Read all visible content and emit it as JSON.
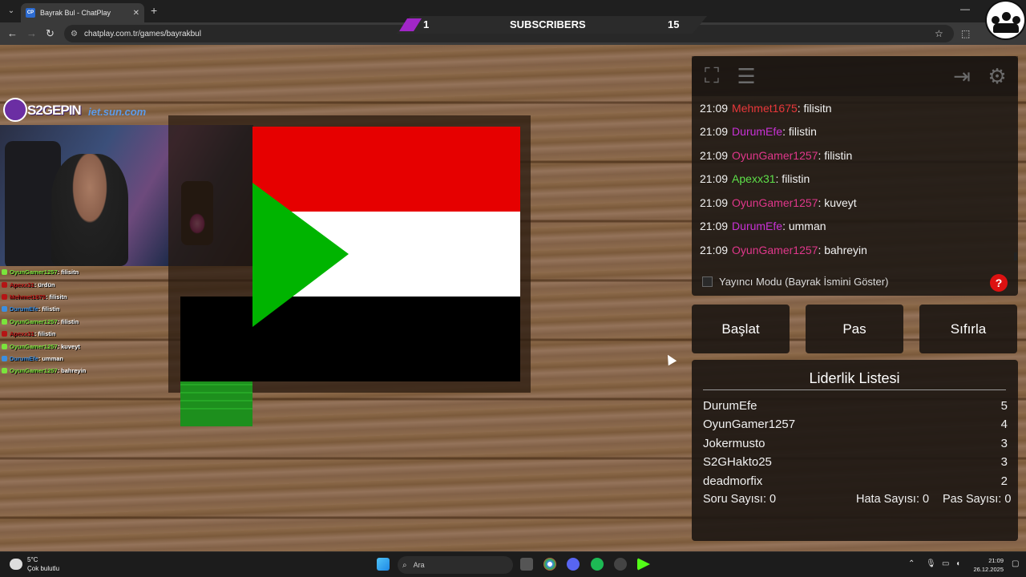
{
  "browser": {
    "tab_title": "Bayrak Bul - ChatPlay",
    "tab_favicon": "CP",
    "url": "chatplay.com.tr/games/bayrakbul"
  },
  "subscribers": {
    "left_value": "1",
    "label": "SUBSCRIBERS",
    "right_value": "15"
  },
  "stream_overlay": {
    "channel_name": "S2GEPIN",
    "sponsor": "iet.sun.com",
    "chat": [
      {
        "user": "OyunGamer1257",
        "msg": "filisitn",
        "color": "#7be33c"
      },
      {
        "user": "Apexx31",
        "msg": "ürdün",
        "color": "#b51515"
      },
      {
        "user": "Mehmet1675",
        "msg": "filisitn",
        "color": "#b51515"
      },
      {
        "user": "DurumEfe",
        "msg": "filistin",
        "color": "#3c8fe0"
      },
      {
        "user": "OyunGamer1257",
        "msg": "filistin",
        "color": "#7be33c"
      },
      {
        "user": "Apexx31",
        "msg": "filistin",
        "color": "#b51515"
      },
      {
        "user": "OyunGamer1257",
        "msg": "kuveyt",
        "color": "#7be33c"
      },
      {
        "user": "DurumEfe",
        "msg": "umman",
        "color": "#3c8fe0"
      },
      {
        "user": "OyunGamer1257",
        "msg": "bahreyin",
        "color": "#7be33c"
      }
    ]
  },
  "flag": {
    "colors": {
      "top": "#e60000",
      "middle": "#ffffff",
      "bottom": "#000000",
      "triangle": "#00b400"
    }
  },
  "panel": {
    "tools": {
      "fullscreen_icon": "expand-icon",
      "list_icon": "document-icon",
      "exit_icon": "exit-icon",
      "settings_icon": "gear-icon"
    },
    "chat": [
      {
        "time": "21:09",
        "user": "Mehmet1675",
        "color": "#e8373a",
        "msg": ": filisitn"
      },
      {
        "time": "21:09",
        "user": "DurumEfe",
        "color": "#c832d6",
        "msg": ": filistin"
      },
      {
        "time": "21:09",
        "user": "OyunGamer1257",
        "color": "#e0378b",
        "msg": ": filistin"
      },
      {
        "time": "21:09",
        "user": "Apexx31",
        "color": "#5ee04a",
        "msg": ": filistin"
      },
      {
        "time": "21:09",
        "user": "OyunGamer1257",
        "color": "#e0378b",
        "msg": ": kuveyt"
      },
      {
        "time": "21:09",
        "user": "DurumEfe",
        "color": "#c832d6",
        "msg": ": umman"
      },
      {
        "time": "21:09",
        "user": "OyunGamer1257",
        "color": "#e0378b",
        "msg": ": bahreyin"
      }
    ],
    "streamer_mode_label": "Yayıncı Modu (Bayrak İsmini Göster)",
    "help_label": "?",
    "buttons": {
      "start": "Başlat",
      "pass": "Pas",
      "reset": "Sıfırla"
    },
    "leaderboard": {
      "title": "Liderlik Listesi",
      "rows": [
        {
          "name": "DurumEfe",
          "score": "5"
        },
        {
          "name": "OyunGamer1257",
          "score": "4"
        },
        {
          "name": "Jokermusto",
          "score": "3"
        },
        {
          "name": "S2GHakto25",
          "score": "3"
        },
        {
          "name": "deadmorfix",
          "score": "2"
        }
      ],
      "question_count": "Soru Sayısı: 0",
      "error_count": "Hata Sayısı: 0",
      "pass_count": "Pas Sayısı: 0"
    }
  },
  "taskbar": {
    "weather_temp": "5°C",
    "weather_desc": "Çok bulutlu",
    "search_placeholder": "Ara",
    "time": "21:09",
    "date": "26.12.2025"
  }
}
